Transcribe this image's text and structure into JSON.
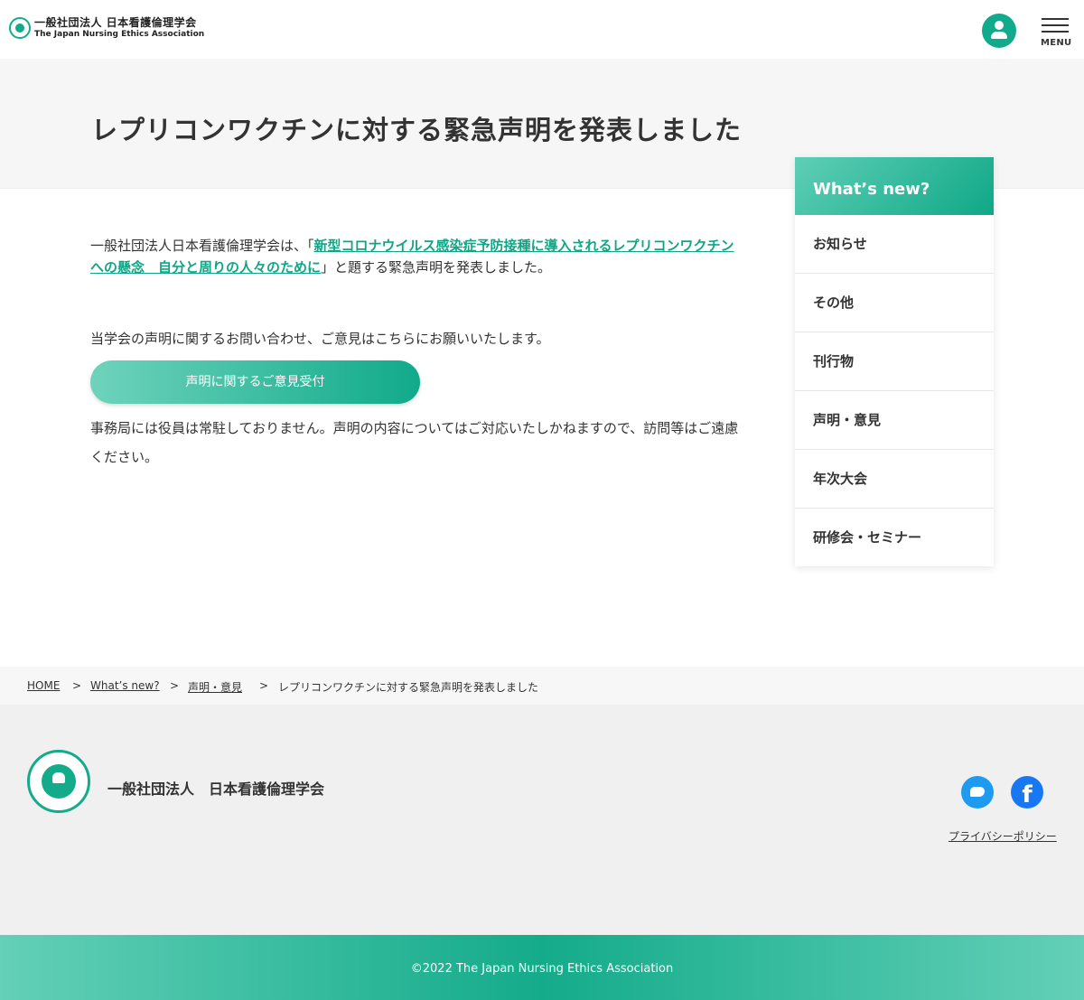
{
  "header": {
    "org_ja": "一般社団法人 日本看護倫理学会",
    "org_en": "The Japan Nursing Ethics Association",
    "menu_label": "MENU"
  },
  "page": {
    "title": "レプリコンワクチンに対する緊急声明を発表しました"
  },
  "content": {
    "para1_prefix": "一般社団法人日本看護倫理学会は、「",
    "para1_link": "新型コロナウイルス感染症予防接種に導入されるレプリコンワクチンへの懸念　自分と周りの人々のために",
    "para1_suffix": "」と題する緊急声明を発表しました。",
    "para2": "当学会の声明に関するお問い合わせ、ご意見はこちらにお願いいたします。",
    "cta_label": "声明に関するご意見受付",
    "para3": "事務局には役員は常駐しておりません。声明の内容についてはご対応いたしかねますので、訪問等はご遠慮ください。"
  },
  "sidebar": {
    "heading": "What’s new?",
    "items": [
      {
        "label": "お知らせ"
      },
      {
        "label": "その他"
      },
      {
        "label": "刊行物"
      },
      {
        "label": "声明・意見"
      },
      {
        "label": "年次大会"
      },
      {
        "label": "研修会・セミナー"
      }
    ]
  },
  "breadcrumb": {
    "home": "HOME",
    "sep": ">",
    "whats_new": "What’s new?",
    "category": "声明・意見",
    "current": "レプリコンワクチンに対する緊急声明を発表しました"
  },
  "footer": {
    "org": "一般社団法人　日本看護倫理学会",
    "privacy": "プライバシーポリシー",
    "facebook_glyph": "f",
    "copyright": "©2022 The Japan Nursing Ethics Association"
  },
  "icons": {
    "user": "user-icon",
    "menu": "hamburger-icon",
    "twitter": "twitter-icon",
    "facebook": "facebook-icon"
  },
  "colors": {
    "accent": "#12aa8c",
    "twitter": "#1d9bf0",
    "facebook": "#1877f2"
  }
}
